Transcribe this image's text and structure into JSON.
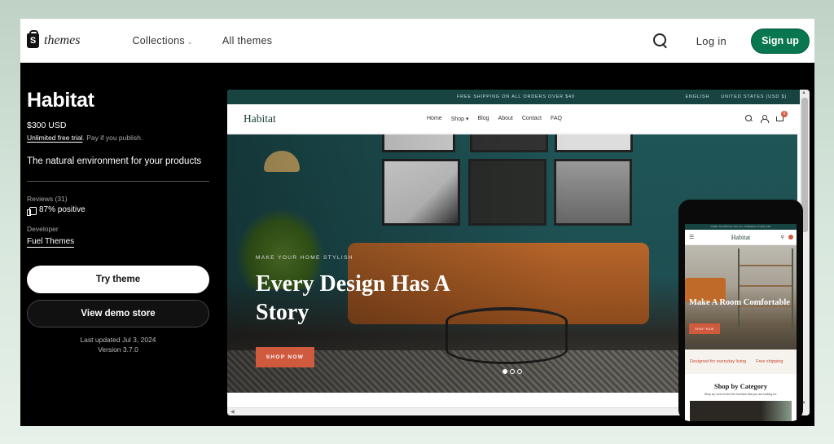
{
  "topbar": {
    "logo_text": "themes",
    "nav": [
      {
        "label": "Collections",
        "has_dropdown": true
      },
      {
        "label": "All themes",
        "has_dropdown": false
      }
    ],
    "search_icon": "search-icon",
    "login_label": "Log in",
    "signup_label": "Sign up",
    "signup_color": "#08764f"
  },
  "theme": {
    "name": "Habitat",
    "price": "$300 USD",
    "trial_link": "Unlimited free trial",
    "trial_note": ". Pay if you publish.",
    "tagline": "The natural environment for your products",
    "reviews_label": "Reviews (31)",
    "reviews_positive": "87% positive",
    "developer_label": "Developer",
    "developer_name": "Fuel Themes",
    "try_label": "Try theme",
    "demo_label": "View demo store",
    "last_updated": "Last updated Jul 3, 2024",
    "version": "Version 3.7.0"
  },
  "preview": {
    "announcement": "FREE SHIPPING ON ALL ORDERS OVER $40",
    "language": "ENGLISH",
    "currency": "UNITED STATES (USD $)",
    "store_name": "Habitat",
    "nav": [
      "Home",
      "Shop",
      "Blog",
      "About",
      "Contact",
      "FAQ"
    ],
    "cart_count": "0",
    "hero": {
      "eyebrow": "MAKE YOUR HOME STYLISH",
      "headline": "Every Design Has A Story",
      "cta": "SHOP NOW",
      "slides": 3,
      "active_slide": 1
    },
    "accent_color": "#cf5a3e",
    "announcement_color": "#174440"
  },
  "mobile": {
    "announcement": "FREE SHIPPING ON ALL ORDERS OVER $40",
    "store_name": "Habitat",
    "hero_title": "Make A Room Comfortable",
    "cta": "SHOP NOW",
    "strip": [
      "Designed for everyday living",
      "Free shipping"
    ],
    "category_title": "Shop by Category",
    "category_sub": "Shop by room to find the furniture that you are looking for."
  }
}
